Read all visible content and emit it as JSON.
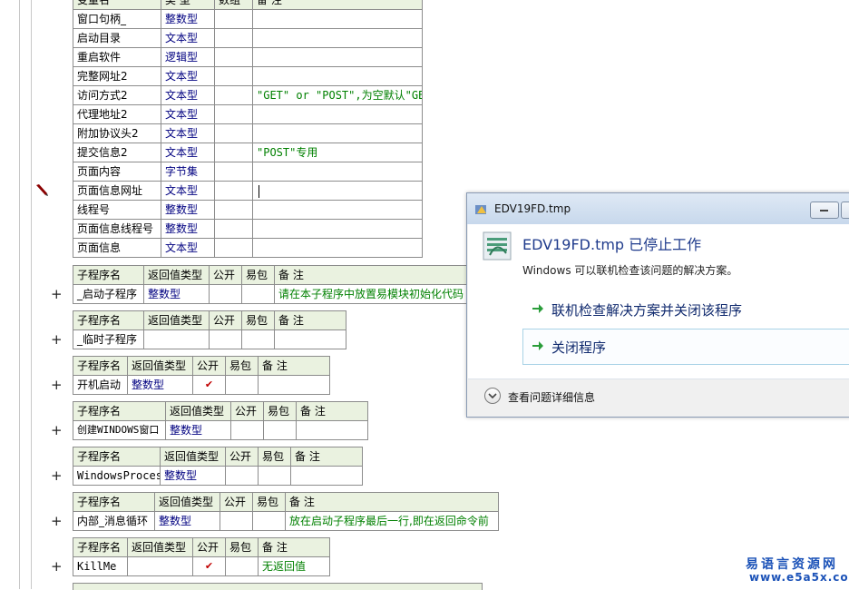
{
  "vars_header": [
    "变量名",
    "类 型",
    "数组",
    "备 注"
  ],
  "vars": [
    {
      "name": "窗口句柄_",
      "type": "整数型",
      "array": "",
      "note": ""
    },
    {
      "name": "启动目录",
      "type": "文本型",
      "array": "",
      "note": ""
    },
    {
      "name": "重启软件",
      "type": "逻辑型",
      "array": "",
      "note": ""
    },
    {
      "name": "完整网址2",
      "type": "文本型",
      "array": "",
      "note": ""
    },
    {
      "name": "访问方式2",
      "type": "文本型",
      "array": "",
      "note": "\"GET\" or \"POST\",为空默认\"GET\""
    },
    {
      "name": "代理地址2",
      "type": "文本型",
      "array": "",
      "note": ""
    },
    {
      "name": "附加协议头2",
      "type": "文本型",
      "array": "",
      "note": ""
    },
    {
      "name": "提交信息2",
      "type": "文本型",
      "array": "",
      "note": "\"POST\"专用"
    },
    {
      "name": "页面内容",
      "type": "字节集",
      "array": "",
      "note": ""
    },
    {
      "name": "页面信息网址",
      "type": "文本型",
      "array": "",
      "note": ""
    },
    {
      "name": "线程号",
      "type": "整数型",
      "array": "",
      "note": ""
    },
    {
      "name": "页面信息线程号",
      "type": "整数型",
      "array": "",
      "note": ""
    },
    {
      "name": "页面信息",
      "type": "文本型",
      "array": "",
      "note": ""
    }
  ],
  "sub_header": [
    "子程序名",
    "返回值类型",
    "公开",
    "易包",
    "备 注"
  ],
  "subs": [
    {
      "name": "_启动子程序",
      "ret": "整数型",
      "public": false,
      "pkg": "",
      "note": "请在本子程序中放置易模块初始化代码"
    },
    {
      "name": "_临时子程序",
      "ret": "",
      "public": false,
      "pkg": "",
      "note": ""
    },
    {
      "name": "开机启动",
      "ret": "整数型",
      "public": true,
      "pkg": "",
      "note": ""
    },
    {
      "name": "创建WINDOWS窗口",
      "ret": "整数型",
      "public": false,
      "pkg": "",
      "note": ""
    },
    {
      "name": "WindowsProcess",
      "ret": "整数型",
      "public": false,
      "pkg": "",
      "note": ""
    },
    {
      "name": "内部_消息循环",
      "ret": "整数型",
      "public": false,
      "pkg": "",
      "note": "放在启动子程序最后一行,即在返回命令前"
    },
    {
      "name": "KillMe",
      "ret": "",
      "public": true,
      "pkg": "",
      "note": "无返回值"
    }
  ],
  "expand_symbol": "+",
  "check_symbol": "✔",
  "dialog": {
    "title": "EDV19FD.tmp",
    "heading": "EDV19FD.tmp 已停止工作",
    "message": "Windows 可以联机检查该问题的解决方案。",
    "option_check": "联机检查解决方案并关闭该程序",
    "option_close": "关闭程序",
    "details": "查看问题详细信息"
  },
  "watermark": {
    "line1": "易语言资源网",
    "line2": "www.e5a5x.com"
  },
  "colors": {
    "type_text": "#000080",
    "note_text": "#008000",
    "header_bg": "#eaf2e0",
    "check": "#c00000",
    "dialog_heading": "#1f3b8c"
  }
}
